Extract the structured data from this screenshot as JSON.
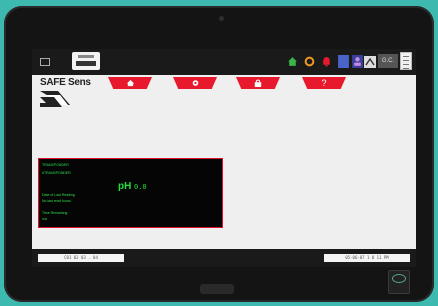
{
  "app": {
    "logo_text": "SAFE Sens"
  },
  "toolbar": {
    "gc_label": "G.C."
  },
  "nav_tabs": [
    {
      "icon": "home-icon"
    },
    {
      "icon": "gear-icon"
    },
    {
      "icon": "lock-icon"
    },
    {
      "label": "?",
      "icon": "help-icon"
    }
  ],
  "panel": {
    "line1": "TRANSPONDER",
    "line2": "#TRANSPONDER",
    "line3": "Date of Last Reading",
    "line4": "No last read found",
    "line5": "Time Remaining",
    "line6": "n/a",
    "ph_label": "pH",
    "ph_value": "0.0"
  },
  "bottombar": {
    "left_field": "C01 02 03 . 04",
    "right_field": "05-06-07 1 0 11 PM"
  },
  "colors": {
    "accent_red": "#e8192c",
    "display_green": "#20e040",
    "bezel": "#141414",
    "background": "#3db9b0"
  }
}
